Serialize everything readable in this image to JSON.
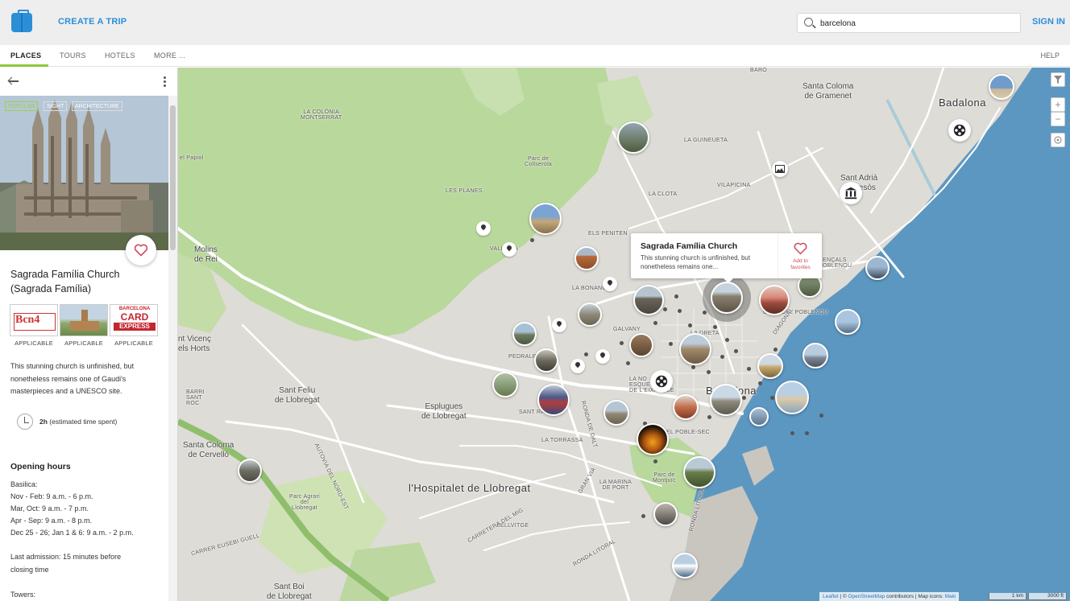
{
  "header": {
    "create_trip": "CREATE A TRIP",
    "search_value": "barcelona",
    "sign_in": "SIGN IN",
    "brand_color": "#2b8fd8"
  },
  "tabs": {
    "places": "PLACES",
    "tours": "TOURS",
    "hotels": "HOTELS",
    "more": "MORE ...",
    "help": "HELP",
    "active_accent": "#8fc73e"
  },
  "panel": {
    "tags": [
      "POPULAR",
      "SIGHT",
      "ARCHITECTURE"
    ],
    "title": "Sagrada Família Church",
    "subtitle": "(Sagrada Família)",
    "passes": [
      {
        "name": "Bcn4",
        "label": "APPLICABLE"
      },
      {
        "name": "park",
        "label": "APPLICABLE"
      },
      {
        "name": "BARCELONA CARD EXPRESS",
        "label": "APPLICABLE"
      }
    ],
    "pass_text": {
      "bcn": "Bcn4",
      "card_line1": "BARCELONA",
      "card_line2": "CARD",
      "card_line3": "EXPRESS"
    },
    "description": "This stunning church is unfinished, but nonetheless remains one of Gaudi's masterpieces and a UNESCO site.",
    "time_value": "2h",
    "time_note": " (estimated time spent)",
    "opening_hours_title": "Opening hours",
    "hours": [
      "Basilica:",
      "Nov - Feb: 9 a.m. - 6 p.m.",
      "Mar, Oct: 9 a.m. - 7 p.m.",
      "Apr - Sep: 9 a.m. - 8 p.m.",
      "Dec 25 - 26; Jan 1 & 6: 9 a.m. - 2 p.m.",
      "",
      "Last admission: 15 minutes before",
      "closing time",
      "",
      "Towers:"
    ]
  },
  "popup": {
    "title": "Sagrada Família Church",
    "description": "This stunning church is unfinished, but nonetheless remains one...",
    "fav_label_1": "Add to",
    "fav_label_2": "favorites",
    "fav_color": "#d24a5e"
  },
  "map": {
    "labels": {
      "badalona": "Badalona",
      "santa_coloma_gramenet": "Santa Coloma\nde Gramenet",
      "sant_adria": "Sant Adrià\nde Besòs",
      "molins": "Molins\nde Rei",
      "sant_vicenc": "nt Vicenç\nels Horts",
      "sant_feliu": "Sant Feliu\nde Llobregat",
      "esplugues": "Esplugues\nde Llobregat",
      "santa_coloma_cervello": "Santa Coloma\nde Cervelló",
      "hospitalet": "l'Hospitalet de Llobregat",
      "sant_boi": "Sant Boi\nde Llobregat",
      "barcelona": "Barcelona",
      "la_colonia": "LA COLÒNIA\nMONTSERRAT",
      "el_papiol": "el Papiol",
      "les_planes": "LES PLANES",
      "collserola": "Parc de\nCollserola",
      "la_guineueta": "LA GUINEUETA",
      "la_clota": "LA CLOTA",
      "vilapicina": "VILAPICINA",
      "els_penitents": "ELS PENITEN",
      "vallvidrera": "VALL  ERA",
      "la_bonanova": "LA BONANO",
      "galvany": "GALVANY",
      "pedralbes": "PEDRALB",
      "sant_ramon": "SANT RAMO",
      "la_torrassa": "LA TORRASSA",
      "la_marina": "LA MARINA\nDE PORT",
      "bellvitge": "BELLVITGE",
      "ronda_litoral": "RONDA LITORAL",
      "gran_via": "GRAN VIA",
      "autovia": "AUTOVIA DEL NORD-EST",
      "barri": "BARRI\nSANT\nROC",
      "baro": "BARO",
      "poble_sec": "EL POBLE-SEC",
      "poblenou": "CUNA DEL POBLENOU",
      "la_dreta": "LA DRETA",
      "nova": "NOVA",
      "la_nova_esquerra": "LA NO\nESQUE\nDE L'EIXAMPLE",
      "encals": "ENÇALS\nOBLENOU",
      "parc_montjuic": "Parc de\nMontjuïc",
      "parc_riu": "Parc Agrari\ndel\nLlobregat",
      "carrer_eusebi": "CARRER EUSEBI GUELL",
      "carretera": "CARRETERA DEL MIG",
      "ronda_dalt": "RONDA DE DALT",
      "diagonal": "DIAGONAL",
      "carrer_ronda": "RONDA LITORAL"
    },
    "attribution_leaflet": "Leaflet",
    "attribution_sep": " | © ",
    "attribution_osm": "OpenStreetMap",
    "attribution_contrib": " contributors | Map icons: ",
    "attribution_maki": "Maki",
    "scale_km": "1 km",
    "scale_ft": "3000 ft",
    "colors": {
      "land": "#dedcd6",
      "park": "#b7d79a",
      "sea": "#5c97c1",
      "road": "#ffffff",
      "urban": "#d6d3cc"
    }
  }
}
